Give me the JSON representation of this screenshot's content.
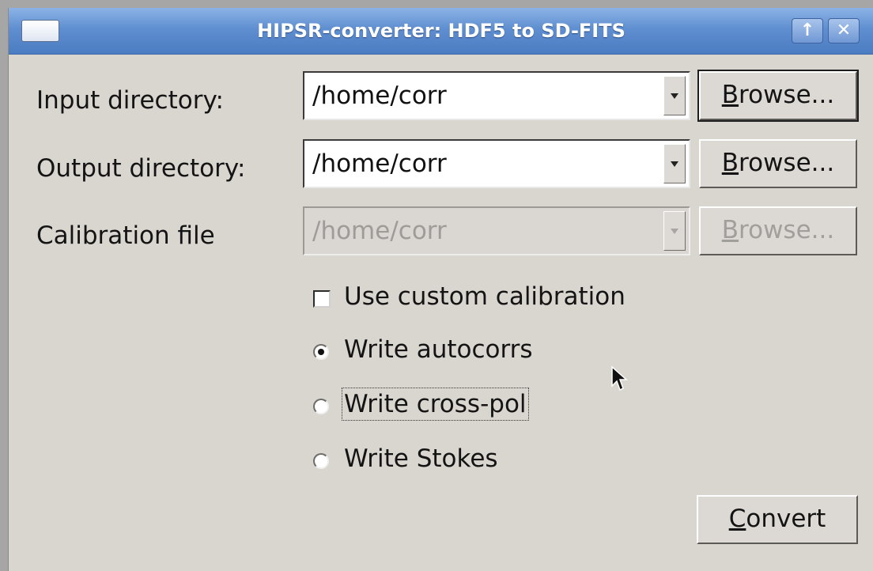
{
  "window": {
    "title": "HIPSR-converter: HDF5 to SD-FITS",
    "up_glyph": "↑",
    "close_glyph": "✕"
  },
  "input": {
    "label": "Input directory:",
    "value": "/home/corr",
    "browse_mnemonic": "B",
    "browse_rest": "rowse..."
  },
  "output": {
    "label": "Output directory:",
    "value": "/home/corr",
    "browse_mnemonic": "B",
    "browse_rest": "rowse..."
  },
  "calibration": {
    "label": "Calibration file",
    "value": "/home/corr",
    "browse_mnemonic": "B",
    "browse_rest": "rowse...",
    "enabled": false
  },
  "options": {
    "custom_calibration": {
      "label": "Use custom calibration",
      "checked": false
    },
    "radios": [
      {
        "label": "Write autocorrs",
        "checked": true
      },
      {
        "label": "Write cross-pol",
        "checked": false
      },
      {
        "label": "Write Stokes",
        "checked": false
      }
    ]
  },
  "convert": {
    "mnemonic": "C",
    "rest": "onvert"
  },
  "icons": {
    "window_menu": "window-menu-icon",
    "up": "arrow-up-icon",
    "close": "close-icon",
    "dropdown": "chevron-down-icon",
    "cursor": "mouse-pointer-icon"
  },
  "colors": {
    "title_bar": "#5f8fd0",
    "window_bg": "#d9d6d0",
    "disabled_text": "#9e9c98"
  }
}
